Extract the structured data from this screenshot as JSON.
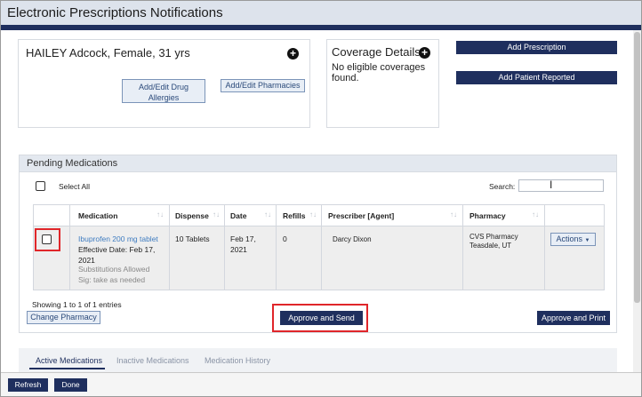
{
  "window": {
    "title": "Electronic Prescriptions Notifications"
  },
  "patient": {
    "name_line": "HAILEY Adcock, Female, 31 yrs",
    "add_icon": "plus-circle-icon",
    "allergies_btn": "Add/Edit Drug Allergies",
    "pharmacies_btn": "Add/Edit Pharmacies"
  },
  "coverage": {
    "title": "Coverage Details",
    "add_icon": "plus-circle-icon",
    "text": "No eligible coverages found."
  },
  "actions": {
    "add_prescription": "Add Prescription",
    "add_patient_reported": "Add Patient Reported"
  },
  "pending": {
    "title": "Pending Medications",
    "select_all": "Select All",
    "search_label": "Search:",
    "search_value": "",
    "columns": [
      "Medication",
      "Dispense",
      "Date",
      "Refills",
      "Prescriber [Agent]",
      "Pharmacy"
    ],
    "row": {
      "medication": "Ibuprofen 200 mg tablet",
      "effective_date": "Effective Date: Feb 17, 2021",
      "substitutions": "Substitutions Allowed",
      "sig": "Sig: take as needed",
      "dispense": "10 Tablets",
      "date": "Feb 17, 2021",
      "refills": "0",
      "prescriber": "Darcy Dixon",
      "pharmacy": "CVS Pharmacy Teasdale, UT",
      "actions_btn": "Actions"
    },
    "showing": "Showing 1 to 1 of 1 entries",
    "change_pharmacy": "Change Pharmacy",
    "approve_send": "Approve and Send",
    "approve_print": "Approve and Print"
  },
  "tabs": [
    "Active Medications",
    "Inactive Medications",
    "Medication History"
  ],
  "footer": {
    "refresh": "Refresh",
    "done": "Done"
  },
  "colors": {
    "navy": "#1f2f5e",
    "highlight": "#e0262a",
    "link": "#3f7cc0"
  }
}
